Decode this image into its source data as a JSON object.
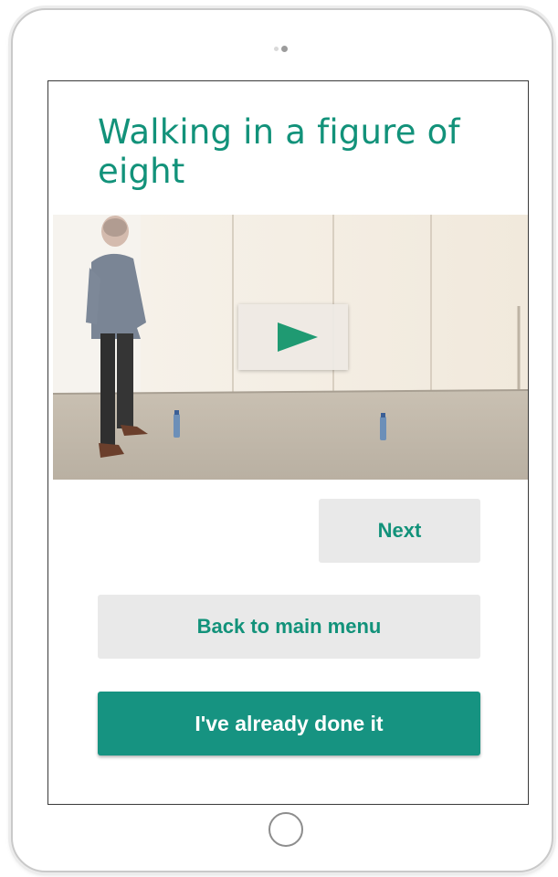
{
  "colors": {
    "accent": "#12927a",
    "secondary_button_bg": "#e9e9e9",
    "primary_button_bg": "#169381",
    "primary_button_text": "#ffffff"
  },
  "screen": {
    "title": "Walking in a figure of eight",
    "video": {
      "play_icon": "play-icon"
    },
    "buttons": {
      "next_label": "Next",
      "back_label": "Back to main menu",
      "done_label": "I've already done it"
    }
  },
  "device": {
    "home_button_icon": "home-button-circle"
  }
}
